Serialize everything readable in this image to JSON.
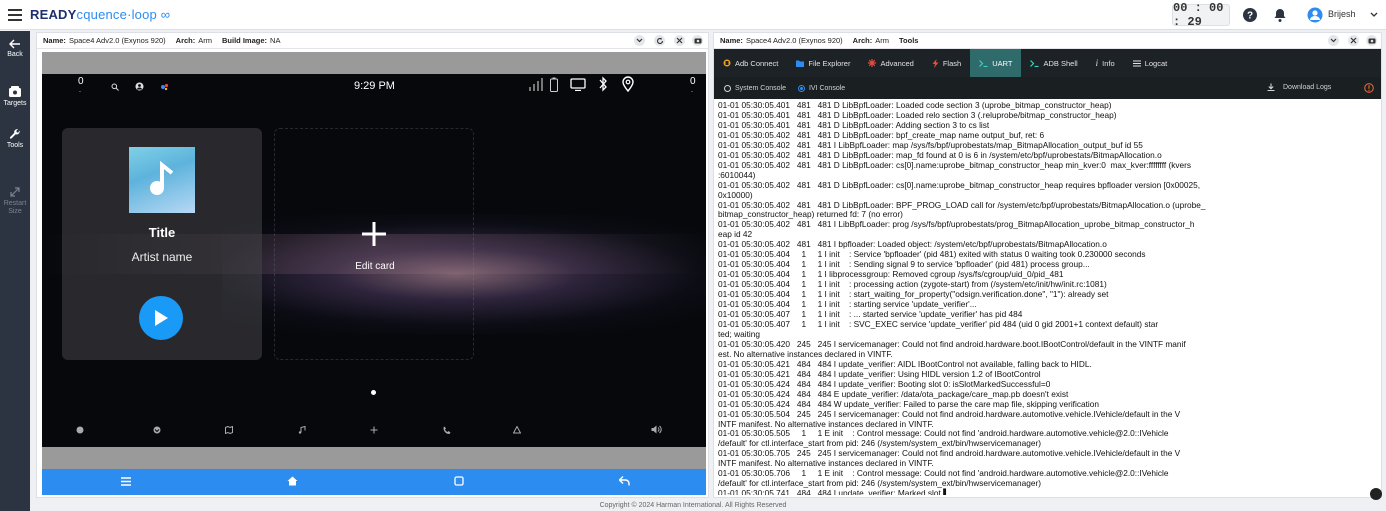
{
  "app": {
    "logo_main": "READY",
    "logo_sub": "cquence·loop",
    "timer": "00 : 00 : 29",
    "user_name": "Brijesh"
  },
  "rail": [
    {
      "label": "Back",
      "icon": "back-arrow-icon",
      "disabled": false
    },
    {
      "label": "Targets",
      "icon": "targets-icon",
      "disabled": false
    },
    {
      "label": "Tools",
      "icon": "wrench-icon",
      "disabled": false
    },
    {
      "label": "Restart Size",
      "icon": "resize-icon",
      "disabled": true
    }
  ],
  "left_panel": {
    "name_label": "Name:",
    "name_value": "Space4 Adv2.0 (Exynos 920)",
    "arch_label": "Arch:",
    "arch_value": "Arm",
    "build_label": "Build Image:",
    "build_value": "NA",
    "device": {
      "status_left_num": "0",
      "status_right_num": "0",
      "status_dot": ".",
      "clock": "9:29 PM",
      "media_title": "Title",
      "media_artist": "Artist name",
      "edit_card": "Edit card"
    }
  },
  "right_panel": {
    "name_label": "Name:",
    "name_value": "Space4 Adv2.0 (Exynos 920)",
    "arch_label": "Arch:",
    "arch_value": "Arm",
    "tools_label": "Tools",
    "tabs": [
      {
        "label": "Adb Connect",
        "icon": "adb-connect-icon",
        "active": false,
        "color": "#f0a020"
      },
      {
        "label": "File Explorer",
        "icon": "folder-icon",
        "active": false,
        "color": "#2d8cf0"
      },
      {
        "label": "Advanced",
        "icon": "advanced-icon",
        "active": false,
        "color": "#e74c3c"
      },
      {
        "label": "Flash",
        "icon": "flash-icon",
        "active": false,
        "color": "#e74c3c"
      },
      {
        "label": "UART",
        "icon": "terminal-icon",
        "active": true,
        "color": "#37d6c0"
      },
      {
        "label": "ADB Shell",
        "icon": "terminal-icon",
        "active": false,
        "color": "#37d6c0"
      },
      {
        "label": "Info",
        "icon": "info-icon",
        "active": false,
        "color": "#dfe3e6"
      },
      {
        "label": "Logcat",
        "icon": "list-icon",
        "active": false,
        "color": "#dfe3e6"
      }
    ],
    "console_system": "System Console",
    "console_ivi": "IVI Console",
    "download_logs": "Download Logs",
    "log_lines": [
      "01-01 05:30:05.401   481   481 D LibBpfLoader: Loaded code section 3 (uprobe_bitmap_constructor_heap)",
      "01-01 05:30:05.401   481   481 D LibBpfLoader: Loaded relo section 3 (.reluprobe/bitmap_constructor_heap)",
      "01-01 05:30:05.401   481   481 D LibBpfLoader: Adding section 3 to cs list",
      "01-01 05:30:05.402   481   481 D LibBpfLoader: bpf_create_map name output_buf, ret: 6",
      "01-01 05:30:05.402   481   481 I LibBpfLoader: map /sys/fs/bpf/uprobestats/map_BitmapAllocation_output_buf id 55",
      "01-01 05:30:05.402   481   481 D LibBpfLoader: map_fd found at 0 is 6 in /system/etc/bpf/uprobestats/BitmapAllocation.o",
      "01-01 05:30:05.402   481   481 D LibBpfLoader: cs[0].name:uprobe_bitmap_constructor_heap min_kver:0  max_kver:ffffffff (kvers",
      ":6010044)",
      "01-01 05:30:05.402   481   481 D LibBpfLoader: cs[0].name:uprobe_bitmap_constructor_heap requires bpfloader version [0x00025,",
      "0x10000)",
      "01-01 05:30:05.402   481   481 D LibBpfLoader: BPF_PROG_LOAD call for /system/etc/bpf/uprobestats/BitmapAllocation.o (uprobe_",
      "bitmap_constructor_heap) returned fd: 7 (no error)",
      "01-01 05:30:05.402   481   481 I LibBpfLoader: prog /sys/fs/bpf/uprobestats/prog_BitmapAllocation_uprobe_bitmap_constructor_h",
      "eap id 42",
      "01-01 05:30:05.402   481   481 I bpfloader: Loaded object: /system/etc/bpf/uprobestats/BitmapAllocation.o",
      "01-01 05:30:05.404     1     1 I init    : Service 'bpfloader' (pid 481) exited with status 0 waiting took 0.230000 seconds",
      "01-01 05:30:05.404     1     1 I init    : Sending signal 9 to service 'bpfloader' (pid 481) process group...",
      "01-01 05:30:05.404     1     1 I libprocessgroup: Removed cgroup /sys/fs/cgroup/uid_0/pid_481",
      "01-01 05:30:05.404     1     1 I init    : processing action (zygote-start) from (/system/etc/init/hw/init.rc:1081)",
      "01-01 05:30:05.404     1     1 I init    : start_waiting_for_property(\"odsign.verification.done\", \"1\"): already set",
      "01-01 05:30:05.404     1     1 I init    : starting service 'update_verifier'...",
      "01-01 05:30:05.407     1     1 I init    : ... started service 'update_verifier' has pid 484",
      "01-01 05:30:05.407     1     1 I init    : SVC_EXEC service 'update_verifier' pid 484 (uid 0 gid 2001+1 context default) star",
      "ted; waiting",
      "01-01 05:30:05.420   245   245 I servicemanager: Could not find android.hardware.boot.IBootControl/default in the VINTF manif",
      "est. No alternative instances declared in VINTF.",
      "01-01 05:30:05.421   484   484 I update_verifier: AIDL IBootControl not available, falling back to HIDL.",
      "01-01 05:30:05.421   484   484 I update_verifier: Using HIDL version 1.2 of IBootControl",
      "01-01 05:30:05.424   484   484 I update_verifier: Booting slot 0: isSlotMarkedSuccessful=0",
      "01-01 05:30:05.424   484   484 E update_verifier: /data/ota_package/care_map.pb doesn't exist",
      "01-01 05:30:05.424   484   484 W update_verifier: Failed to parse the care map file, skipping verification",
      "01-01 05:30:05.504   245   245 I servicemanager: Could not find android.hardware.automotive.vehicle.IVehicle/default in the V",
      "INTF manifest. No alternative instances declared in VINTF.",
      "01-01 05:30:05.505     1     1 E init    : Control message: Could not find 'android.hardware.automotive.vehicle@2.0::IVehicle",
      "/default' for ctl.interface_start from pid: 246 (/system/system_ext/bin/hwservicemanager)",
      "01-01 05:30:05.705   245   245 I servicemanager: Could not find android.hardware.automotive.vehicle.IVehicle/default in the V",
      "INTF manifest. No alternative instances declared in VINTF.",
      "01-01 05:30:05.706     1     1 E init    : Control message: Could not find 'android.hardware.automotive.vehicle@2.0::IVehicle",
      "/default' for ctl.interface_start from pid: 246 (/system/system_ext/bin/hwservicemanager)",
      "01-01 05:30:05.741   484   484 I update_verifier: Marked slot ▌"
    ]
  },
  "footer": "Copyright © 2024 Harman International. All Rights Reserved"
}
